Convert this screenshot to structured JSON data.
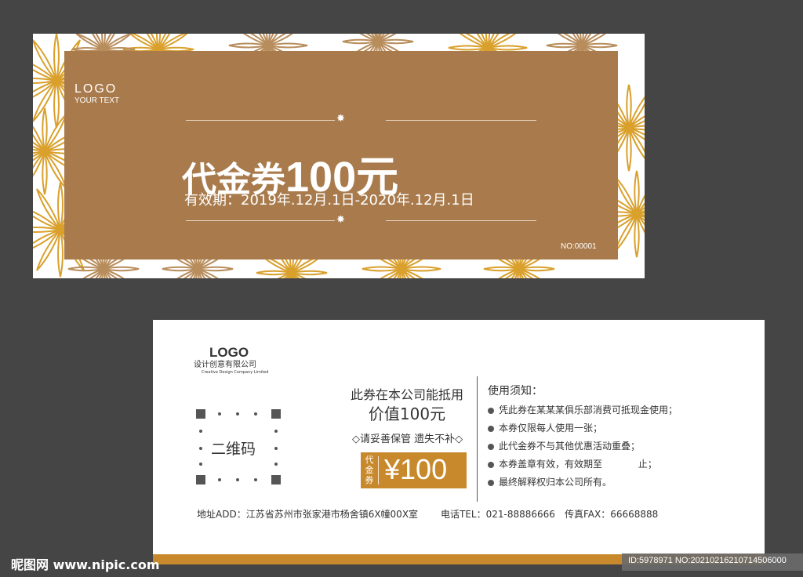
{
  "colors": {
    "background": "#454545",
    "panel_brown": "#a97b4c",
    "gold": "#c8892d",
    "pattern_gold": "#d9a02c",
    "pattern_brown": "#b88d5c",
    "white": "#ffffff"
  },
  "front": {
    "logo": "LOGO",
    "logo_sub": "YOUR TEXT",
    "title_cn": "代金券",
    "title_amount": "100元",
    "validity": "有效期：2019年.12月.1日-2020年.12月.1日",
    "serial": "NO:00001",
    "star_icon": "star-icon"
  },
  "back": {
    "logo": "LOGO",
    "company_cn": "设计创意有限公司",
    "company_en": "Creative Design Company Limited",
    "qr_label": "二维码",
    "use_line1": "此券在本公司能抵用",
    "use_line2": "价值100元",
    "keep_note": "◇请妥善保管 遗失不补◇",
    "mini_coupon_label": "代金券",
    "mini_coupon_amount": "¥100",
    "notice_title": "使用须知：",
    "notice_items": [
      "凭此券在某某某俱乐部消费可抵现金使用；",
      "本券仅限每人使用一张；",
      "此代金券不与其他优惠活动重叠；",
      "本券盖章有效，有效期至            止；",
      "最终解释权归本公司所有。"
    ],
    "address": "地址ADD：江苏省苏州市张家港市杨舍镇6X幢00X室",
    "phone": "电话TEL：021-88886666",
    "fax": "传真FAX：66668888"
  },
  "watermark": {
    "site": "昵图网 www.nipic.com",
    "id_text": "ID:5978971 NO:20210216210714506000"
  }
}
